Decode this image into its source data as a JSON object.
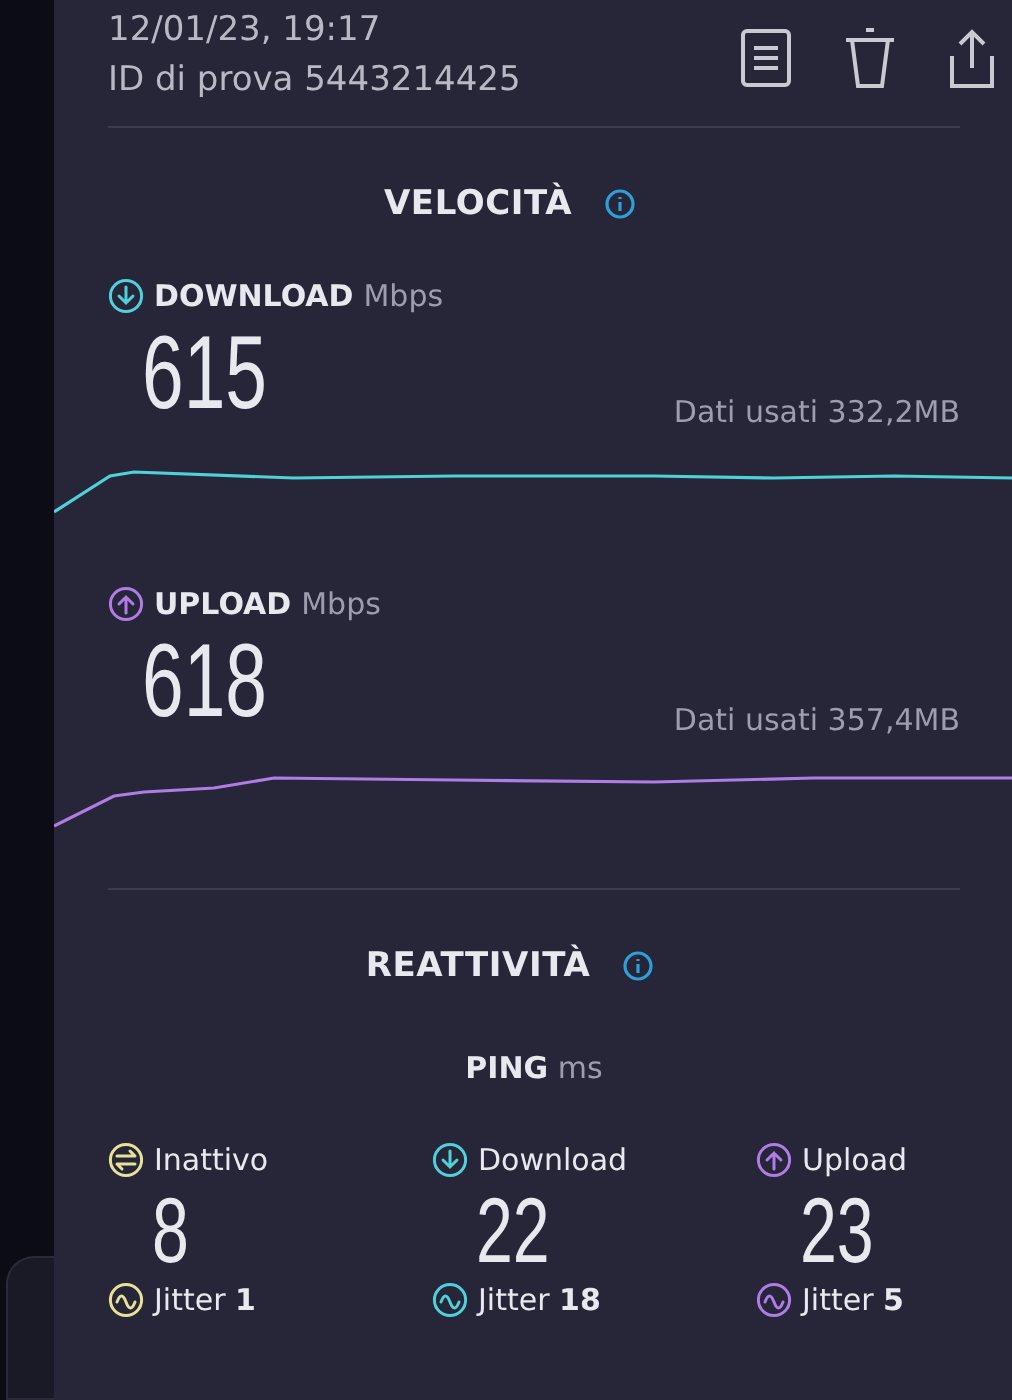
{
  "header": {
    "datetime": "12/01/23, 19:17",
    "test_id": "ID di prova 5443214425"
  },
  "speed": {
    "title": "VELOCITÀ",
    "metrics": [
      {
        "kind": "download",
        "label": "DOWNLOAD",
        "unit": "Mbps",
        "value": "615",
        "data_used": "Dati usati 332,2MB",
        "color": "#4fd1d9"
      },
      {
        "kind": "upload",
        "label": "UPLOAD",
        "unit": "Mbps",
        "value": "618",
        "data_used": "Dati usati 357,4MB",
        "color": "#b07ce6"
      }
    ]
  },
  "responsiveness": {
    "title": "REATTIVITÀ",
    "ping_label": "PING",
    "ping_unit": "ms",
    "columns": [
      {
        "kind": "idle",
        "label": "Inattivo",
        "value": "8",
        "jitter": "Jitter **1**",
        "color": "#e6e29a"
      },
      {
        "kind": "download",
        "label": "Download",
        "value": "22",
        "jitter": "Jitter **18**",
        "color": "#4fd1d9"
      },
      {
        "kind": "upload",
        "label": "Upload",
        "value": "23",
        "jitter": "Jitter **5**",
        "color": "#b07ce6"
      }
    ]
  }
}
